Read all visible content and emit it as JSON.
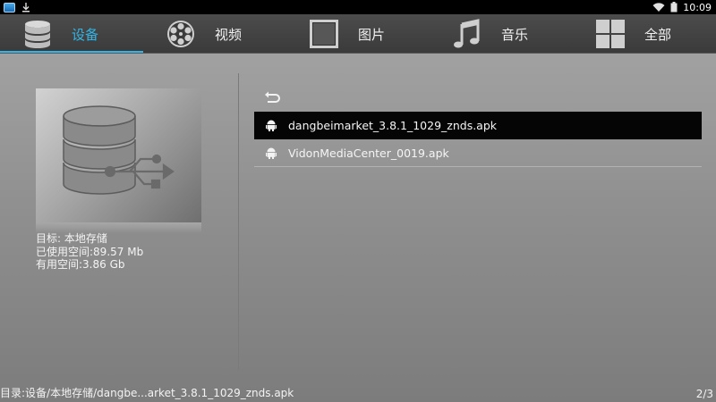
{
  "status_bar": {
    "time": "10:09",
    "icons": [
      "app-icon",
      "download-icon",
      "wifi-icon",
      "battery-icon"
    ]
  },
  "tabs": [
    {
      "label": "设备",
      "icon": "storage-icon",
      "active": true
    },
    {
      "label": "视频",
      "icon": "film-reel-icon",
      "active": false
    },
    {
      "label": "图片",
      "icon": "picture-frame-icon",
      "active": false
    },
    {
      "label": "音乐",
      "icon": "music-note-icon",
      "active": false
    },
    {
      "label": "全部",
      "icon": "grid-icon",
      "active": false
    }
  ],
  "device": {
    "icon": "usb-storage-icon",
    "target": "目标: 本地存储",
    "used": "已使用空间:89.57 Mb",
    "free": "有用空间:3.86 Gb"
  },
  "file_list": {
    "back_icon": "back-arrow-icon",
    "items": [
      {
        "name": "dangbeimarket_3.8.1_1029_znds.apk",
        "selected": true
      },
      {
        "name": "VidonMediaCenter_0019.apk",
        "selected": false
      }
    ]
  },
  "footer": {
    "path": "目录:设备/本地存储/dangbe...arket_3.8.1_1029_znds.apk",
    "page": "2/3"
  },
  "colors": {
    "accent": "#33b5e5",
    "selected_row": "#050505",
    "tabbar": "#3f3f3f"
  }
}
